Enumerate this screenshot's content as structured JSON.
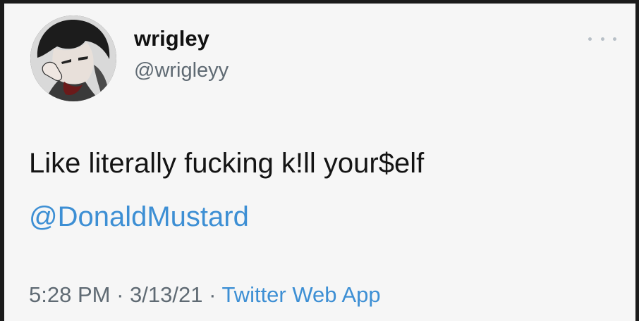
{
  "author": {
    "display_name": "wrigley",
    "handle": "@wrigleyy",
    "avatar_icon": "anime-character-avatar"
  },
  "tweet": {
    "text": "Like literally fucking k!ll your$elf",
    "mention": "@DonaldMustard"
  },
  "meta": {
    "time": "5:28 PM",
    "separator_1": " · ",
    "date": "3/13/21",
    "separator_2": " · ",
    "source": "Twitter Web App"
  },
  "colors": {
    "link": "#3d8fd4",
    "secondary_text": "#5f6a73",
    "primary_text": "#141414",
    "background": "#f6f6f6"
  }
}
